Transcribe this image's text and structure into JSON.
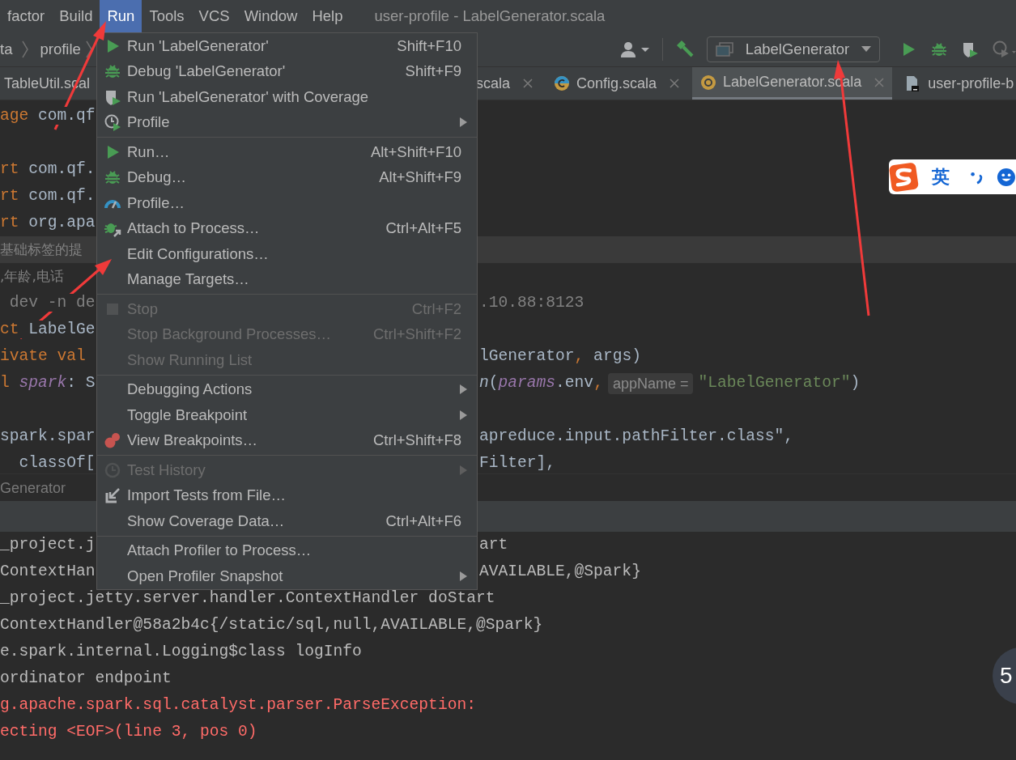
{
  "menubar": {
    "items": [
      {
        "label": "factor",
        "selected": false
      },
      {
        "label": "Build",
        "selected": false
      },
      {
        "label": "Run",
        "selected": true
      },
      {
        "label": "Tools",
        "selected": false
      },
      {
        "label": "VCS",
        "selected": false
      },
      {
        "label": "Window",
        "selected": false
      },
      {
        "label": "Help",
        "selected": false
      }
    ],
    "title": "user-profile - LabelGenerator.scala"
  },
  "breadcrumbs": [
    "ta",
    "profile"
  ],
  "run_config": {
    "label": "LabelGenerator"
  },
  "editor_tabs": [
    {
      "label": "TableUtil.scal",
      "kind": "none",
      "selected": false,
      "closable": false
    },
    {
      "label": "scala",
      "kind": "none",
      "selected": false,
      "closable": true
    },
    {
      "label": "Config.scala",
      "kind": "class",
      "selected": false,
      "closable": true
    },
    {
      "label": "LabelGenerator.scala",
      "kind": "object",
      "selected": true,
      "closable": true
    },
    {
      "label": "user-profile-b",
      "kind": "file",
      "selected": false,
      "closable": false
    }
  ],
  "code_lines": [
    {
      "highlighted": false,
      "left": [
        {
          "kind": "keyword",
          "text": "age"
        },
        {
          "kind": "plain",
          "text": " com.qf"
        }
      ]
    },
    {
      "highlighted": false
    },
    {
      "highlighted": false,
      "left": [
        {
          "kind": "keyword",
          "text": "rt"
        },
        {
          "kind": "plain",
          "text": " com.qf."
        }
      ]
    },
    {
      "highlighted": false,
      "left": [
        {
          "kind": "keyword",
          "text": "rt"
        },
        {
          "kind": "plain",
          "text": " com.qf."
        }
      ]
    },
    {
      "highlighted": false,
      "left": [
        {
          "kind": "keyword",
          "text": "rt"
        },
        {
          "kind": "plain",
          "text": " org.apa"
        }
      ]
    },
    {
      "highlighted": true,
      "left": [
        {
          "kind": "comment",
          "text": "基础标签的提"
        }
      ]
    },
    {
      "highlighted": false,
      "left": [
        {
          "kind": "comment",
          "text": ",年龄,电话"
        }
      ]
    },
    {
      "highlighted": false,
      "left": [
        {
          "kind": "comment",
          "text": " dev -n de"
        }
      ],
      "right": [
        {
          "kind": "comment",
          "text": ".10.88:8123"
        }
      ]
    },
    {
      "highlighted": false,
      "left": [
        {
          "kind": "keyword",
          "text": "ct"
        },
        {
          "kind": "plain",
          "text": " LabelGe"
        }
      ]
    },
    {
      "highlighted": false,
      "left": [
        {
          "kind": "keyword",
          "text": "ivate val"
        }
      ],
      "right": [
        {
          "kind": "plain",
          "text": "lGenerator"
        },
        {
          "kind": "keyword",
          "text": ","
        },
        {
          "kind": "plain",
          "text": " args)"
        }
      ]
    },
    {
      "highlighted": false,
      "left": [
        {
          "kind": "keyword",
          "text": "l"
        },
        {
          "kind": "field",
          "text": " spark"
        },
        {
          "kind": "plain",
          "text": ": S"
        }
      ],
      "right": [
        {
          "kind": "function",
          "text": "n"
        },
        {
          "kind": "plain",
          "text": "("
        },
        {
          "kind": "field",
          "text": "params"
        },
        {
          "kind": "plain",
          "text": ".env"
        },
        {
          "kind": "keyword",
          "text": ","
        },
        {
          "kind": "hint",
          "text": "appName ="
        },
        {
          "kind": "string",
          "text": "\"LabelGenerator\""
        },
        {
          "kind": "plain",
          "text": ")"
        }
      ]
    },
    {
      "highlighted": false
    },
    {
      "highlighted": false,
      "left": [
        {
          "kind": "plain",
          "text": "spark.spar"
        }
      ],
      "right": [
        {
          "kind": "plain",
          "text": "apreduce.input.pathFilter.class\","
        }
      ]
    },
    {
      "highlighted": false,
      "left": [
        {
          "kind": "plain",
          "text": "  classOf["
        }
      ],
      "right": [
        {
          "kind": "plain",
          "text": "Filter],"
        }
      ]
    }
  ],
  "editor_breadcrumb": "Generator",
  "console_lines": [
    {
      "kind": "info",
      "left": "_project.j",
      "right": "art"
    },
    {
      "kind": "info",
      "left": "ContextHan",
      "right": "AVAILABLE,@Spark}"
    },
    {
      "kind": "info",
      "left": "_project.jetty.server.handler.ContextHandler doStart"
    },
    {
      "kind": "info",
      "left": "ContextHandler@58a2b4c{/static/sql,null,AVAILABLE,@Spark}"
    },
    {
      "kind": "info",
      "left": "e.spark.internal.Logging$class logInfo"
    },
    {
      "kind": "info",
      "left": "ordinator endpoint"
    },
    {
      "kind": "error",
      "left": "g.apache.spark.sql.catalyst.parser.ParseException:"
    },
    {
      "kind": "error",
      "left": "ecting <EOF>(line 3, pos 0)"
    }
  ],
  "run_menu": {
    "sections": [
      [
        {
          "kind": "run",
          "label": "Run 'LabelGenerator'",
          "shortcut": "Shift+F10",
          "submenu": false,
          "disabled": false
        },
        {
          "kind": "debug",
          "label": "Debug 'LabelGenerator'",
          "shortcut": "Shift+F9",
          "submenu": false,
          "disabled": false
        },
        {
          "kind": "coverage",
          "label": "Run 'LabelGenerator' with Coverage",
          "submenu": false,
          "disabled": false
        },
        {
          "kind": "profile",
          "label": "Profile",
          "submenu": true,
          "disabled": false
        }
      ],
      [
        {
          "kind": "run",
          "label": "Run…",
          "shortcut": "Alt+Shift+F10",
          "submenu": false,
          "disabled": false
        },
        {
          "kind": "debug",
          "label": "Debug…",
          "shortcut": "Alt+Shift+F9",
          "submenu": false,
          "disabled": false
        },
        {
          "kind": "gauge",
          "label": "Profile…",
          "submenu": false,
          "disabled": false
        },
        {
          "kind": "attach",
          "label": "Attach to Process…",
          "shortcut": "Ctrl+Alt+F5",
          "submenu": false,
          "disabled": false
        },
        {
          "kind": "plain",
          "label": "Edit Configurations…",
          "submenu": false,
          "disabled": false
        },
        {
          "kind": "plain",
          "label": "Manage Targets…",
          "submenu": false,
          "disabled": false
        }
      ],
      [
        {
          "kind": "stop",
          "label": "Stop",
          "shortcut": "Ctrl+F2",
          "submenu": false,
          "disabled": true
        },
        {
          "kind": "plain",
          "label": "Stop Background Processes…",
          "shortcut": "Ctrl+Shift+F2",
          "submenu": false,
          "disabled": true
        },
        {
          "kind": "plain",
          "label": "Show Running List",
          "submenu": false,
          "disabled": true
        }
      ],
      [
        {
          "kind": "plain",
          "label": "Debugging Actions",
          "submenu": true,
          "disabled": false
        },
        {
          "kind": "plain",
          "label": "Toggle Breakpoint",
          "submenu": true,
          "disabled": false
        },
        {
          "kind": "breakpoints",
          "label": "View Breakpoints…",
          "shortcut": "Ctrl+Shift+F8",
          "submenu": false,
          "disabled": false
        }
      ],
      [
        {
          "kind": "history",
          "label": "Test History",
          "submenu": true,
          "disabled": true
        },
        {
          "kind": "import",
          "label": "Import Tests from File…",
          "submenu": false,
          "disabled": false
        },
        {
          "kind": "plain",
          "label": "Show Coverage Data…",
          "shortcut": "Ctrl+Alt+F6",
          "submenu": false,
          "disabled": false
        }
      ],
      [
        {
          "kind": "plain",
          "label": "Attach Profiler to Process…",
          "submenu": false,
          "disabled": false
        },
        {
          "kind": "plain",
          "label": "Open Profiler Snapshot",
          "submenu": true,
          "disabled": false
        }
      ]
    ]
  },
  "ime_bar": {
    "language": "英"
  },
  "floating_badge": {
    "label": "5"
  }
}
